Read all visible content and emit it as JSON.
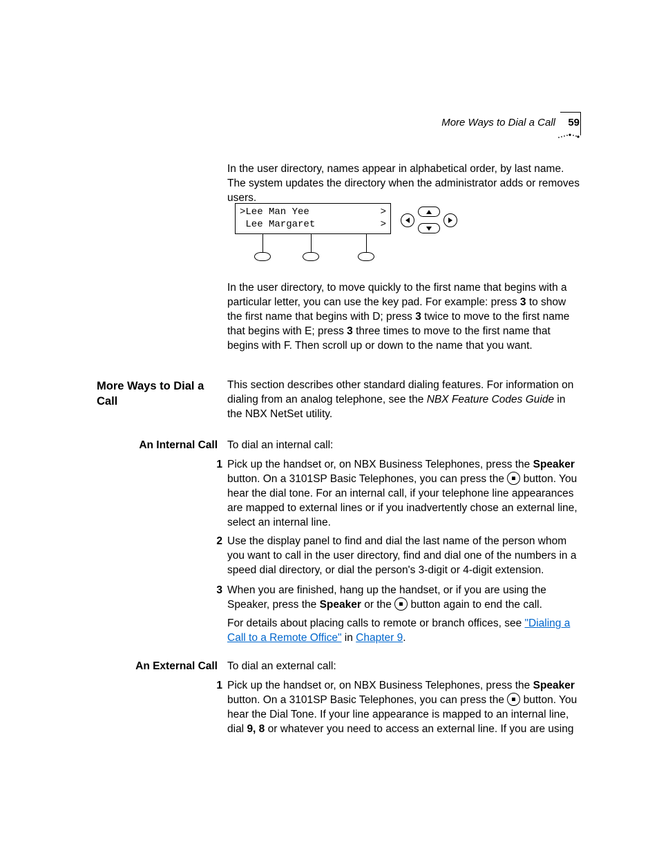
{
  "header": {
    "running_title": "More Ways to Dial a Call",
    "page_number": "59"
  },
  "intro_paragraph": "In the user directory, names appear in alphabetical order, by last name. The system updates the directory when the administrator adds or removes users.",
  "lcd": {
    "row1_left": ">Lee Man Yee",
    "row1_right": ">",
    "row2_left": " Lee Margaret",
    "row2_right": ">"
  },
  "keypad_paragraph": {
    "a": "In the user directory, to move quickly to the first name that begins with a particular letter, you can use the key pad. For example: press ",
    "key1": "3",
    "b": " to show the first name that begins with D; press ",
    "key2": "3",
    "c": " twice to move to the first name that begins with E; press ",
    "key3": "3",
    "d": " three times to move to the first name that begins with F. Then scroll up or down to the name that you want."
  },
  "section": {
    "heading": "More Ways to Dial a Call",
    "intro_a": "This section describes other standard dialing features. For information on dialing from an analog telephone, see the ",
    "intro_ital": "NBX Feature Codes Guide",
    "intro_b": " in the NBX NetSet utility."
  },
  "internal": {
    "heading": "An Internal Call",
    "lead": "To dial an internal call:",
    "step1": {
      "a": "Pick up the handset or, on NBX Business Telephones, press the ",
      "speaker": "Speaker",
      "b": " button. On a 3101SP Basic Telephones, you can press the ",
      "c": " button. You hear the dial tone. For an internal call, if your telephone line appearances are mapped to external lines or if you inadvertently chose an external line, select an internal line."
    },
    "step2": "Use the display panel to find and dial the last name of the person whom you want to call in the user directory, find and dial one of the numbers in a speed dial directory, or dial the person's 3-digit or 4-digit extension.",
    "step3": {
      "a": "When you are finished, hang up the handset, or if you are using the Speaker, press the ",
      "speaker": "Speaker",
      "b": " or the ",
      "c": " button again to end the call."
    },
    "footer": {
      "a": "For details about placing calls to remote or branch offices, see ",
      "link1": "\"Dialing a Call to a Remote Office\"",
      "b": " in ",
      "link2": "Chapter 9",
      "c": "."
    }
  },
  "external": {
    "heading": "An External Call",
    "lead": "To dial an external call:",
    "step1": {
      "a": "Pick up the handset or, on NBX Business Telephones, press the ",
      "speaker": "Speaker",
      "b": " button. On a 3101SP Basic Telephones, you can press the ",
      "c": " button. You hear the Dial Tone. If your line appearance is mapped to an internal line, dial ",
      "digits": "9, 8",
      "d": " or whatever you need to access an external line. If you are using"
    }
  }
}
